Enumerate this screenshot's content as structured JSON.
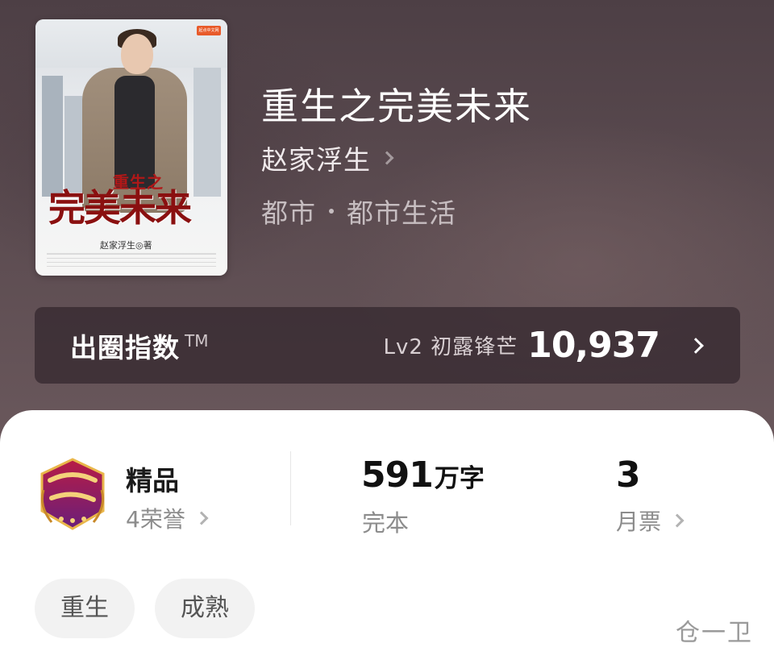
{
  "book": {
    "title": "重生之完美未来",
    "author": "赵家浮生",
    "genre_main": "都市",
    "genre_sub": "都市生活"
  },
  "cover": {
    "subtitle": "重生之",
    "title": "完美未来",
    "author_line": "赵家浮生◎著",
    "publisher": "起点中文网"
  },
  "index_bar": {
    "label": "出圈指数",
    "tm": "TM",
    "level": "Lv2 初露锋芒",
    "value": "10,937"
  },
  "stats": {
    "quality": {
      "title": "精品",
      "honors": "4荣誉",
      "badge_icon": "premium-channel-badge"
    },
    "words": {
      "number": "591",
      "unit": "万字",
      "status": "完本"
    },
    "votes": {
      "number": "3",
      "label": "月票"
    }
  },
  "tags": [
    "重生",
    "成熟"
  ],
  "watermark": "仓一卫",
  "colors": {
    "hero_bg": "#5b4b50",
    "index_bar_bg": "#3a2c33",
    "badge_red": "#a3183c",
    "badge_purple": "#7a2a8a"
  }
}
